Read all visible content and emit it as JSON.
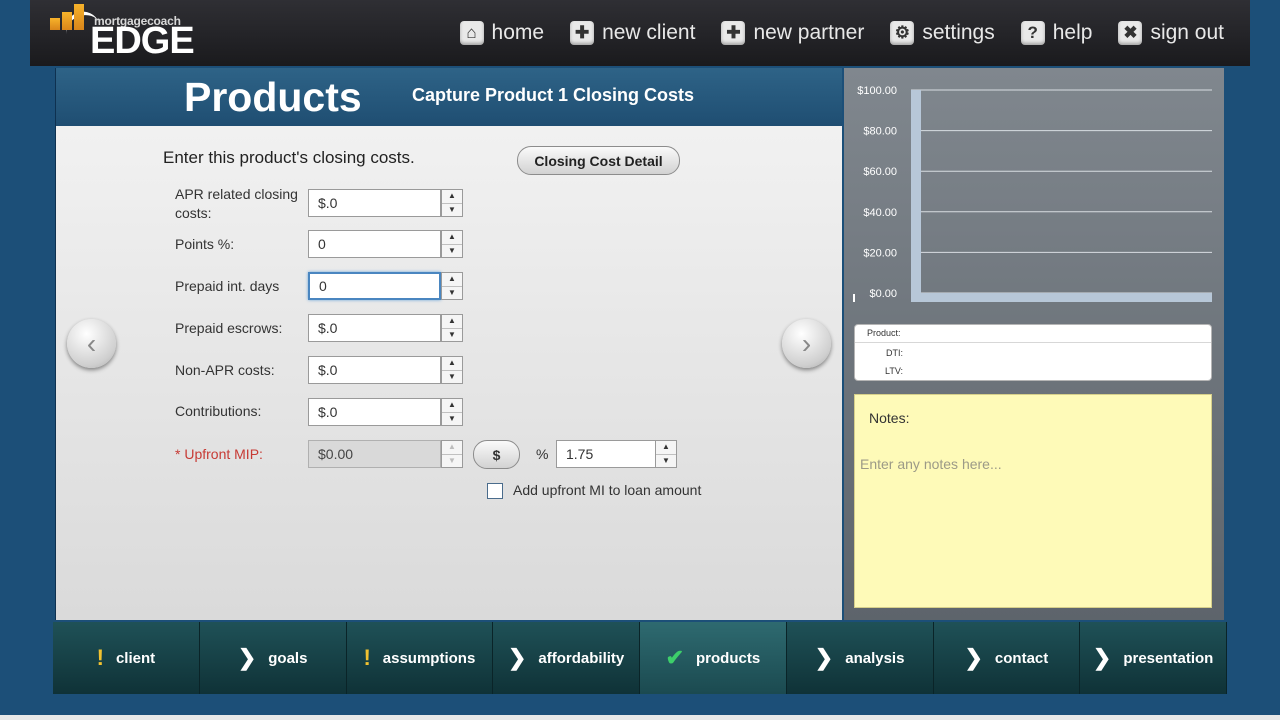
{
  "logo": {
    "small_text": "mortgagecoach",
    "big_text": "EDGE"
  },
  "nav": [
    {
      "label": "home",
      "icon": "home-icon",
      "glyph": "⌂"
    },
    {
      "label": "new client",
      "icon": "plus-icon",
      "glyph": "✚"
    },
    {
      "label": "new partner",
      "icon": "plus-icon",
      "glyph": "✚"
    },
    {
      "label": "settings",
      "icon": "gear-icon",
      "glyph": "⚙"
    },
    {
      "label": "help",
      "icon": "question-icon",
      "glyph": "?"
    },
    {
      "label": "sign out",
      "icon": "close-icon",
      "glyph": "✖"
    }
  ],
  "page": {
    "title": "Products",
    "subtitle": "Capture Product 1 Closing Costs",
    "instructions": "Enter this product's closing costs.",
    "detail_button": "Closing Cost Detail"
  },
  "form": {
    "apr_label": "APR related closing costs:",
    "apr_value": "$.0",
    "points_label": "Points %:",
    "points_value": "0",
    "prepaid_int_label": "Prepaid int. days",
    "prepaid_int_value": "0",
    "prepaid_escrows_label": "Prepaid escrows:",
    "prepaid_escrows_value": "$.0",
    "non_apr_label": "Non-APR costs:",
    "non_apr_value": "$.0",
    "contributions_label": "Contributions:",
    "contributions_value": "$.0",
    "upfront_mip_label": "* Upfront MIP:",
    "upfront_mip_value": "$0.00",
    "dollar_button": "$",
    "percent_symbol": "%",
    "percent_value": "1.75",
    "add_mi_label": "Add upfront MI to loan amount",
    "add_mi_checked": false
  },
  "chart_data": {
    "type": "bar",
    "categories": [
      ""
    ],
    "values": [
      0
    ],
    "ylim": [
      0,
      100
    ],
    "yticks": [
      "$0.00",
      "$20.00",
      "$40.00",
      "$60.00",
      "$80.00",
      "$100.00"
    ],
    "grid": true
  },
  "summary": {
    "product_label": "Product:",
    "dti_label": "DTI:",
    "ltv_label": "LTV:"
  },
  "notes": {
    "title": "Notes:",
    "placeholder": "Enter any notes here..."
  },
  "tabs": [
    {
      "label": "client",
      "status": "warning"
    },
    {
      "label": "goals",
      "status": "arrow"
    },
    {
      "label": "assumptions",
      "status": "warning"
    },
    {
      "label": "affordability",
      "status": "arrow"
    },
    {
      "label": "products",
      "status": "check",
      "active": true
    },
    {
      "label": "analysis",
      "status": "arrow"
    },
    {
      "label": "contact",
      "status": "arrow"
    },
    {
      "label": "presentation",
      "status": "arrow"
    }
  ],
  "colors": {
    "background": "#1c4f78",
    "header_blue": "#2a5f86",
    "required_red": "#c73a34",
    "notes_yellow": "#fefab8",
    "tab_bar": "#174449",
    "check_green": "#3dcf6a",
    "warning_yellow": "#f2c230"
  }
}
